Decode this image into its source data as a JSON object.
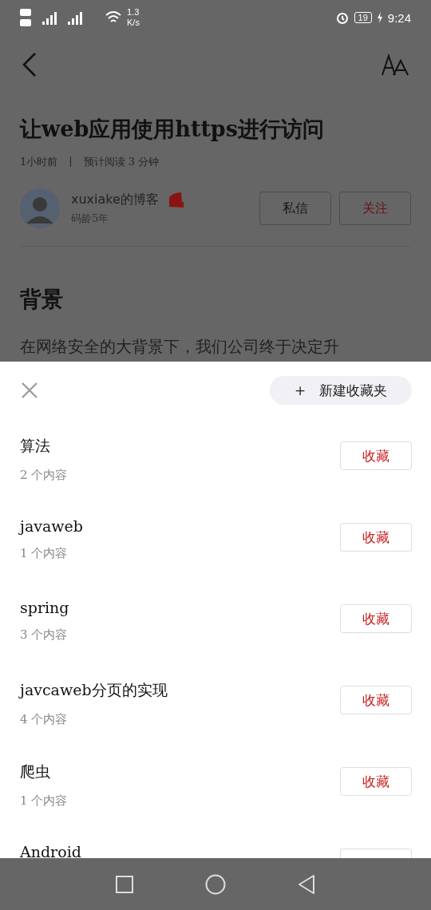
{
  "status_bar": {
    "network_speed": "1.3 K/s",
    "battery": "19",
    "time": "9:24"
  },
  "article": {
    "title": "让web应用使用https进行访问",
    "time_ago": "1小时前",
    "separator": "|",
    "read_time": "预计阅读 3 分钟",
    "author": {
      "name": "xuxiake的博客",
      "seniority": "码龄5年"
    },
    "buttons": [
      {
        "label": "私信",
        "kind": "plain"
      },
      {
        "label": "关注",
        "kind": "accent"
      }
    ],
    "heading": "背景",
    "paragraph": "在网络安全的大背景下，我们公司终于决定升"
  },
  "sheet": {
    "new_folder_button": "+　新建收藏夹",
    "folders": [
      {
        "name": "算法",
        "count": "2 个内容",
        "button": "收藏"
      },
      {
        "name": "javaweb",
        "count": "1 个内容",
        "button": "收藏"
      },
      {
        "name": "spring",
        "count": "3 个内容",
        "button": "收藏"
      },
      {
        "name": "javcaweb分页的实现",
        "count": "4 个内容",
        "button": "收藏"
      },
      {
        "name": "爬虫",
        "count": "1 个内容",
        "button": "收藏"
      },
      {
        "name": "Android"
      }
    ]
  }
}
